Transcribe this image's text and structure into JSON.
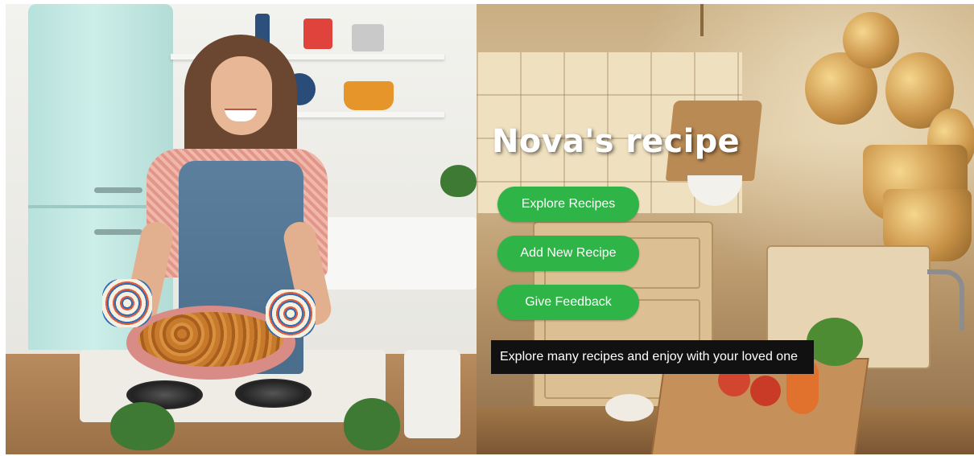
{
  "hero": {
    "title": "Nova's recipe",
    "tagline": "Explore many recipes and enjoy with your loved one"
  },
  "actions": {
    "explore_label": "Explore Recipes",
    "add_label": "Add New Recipe",
    "feedback_label": "Give Feedback"
  },
  "images": {
    "left_photo": "woman-holding-baked-dish-in-kitchen",
    "right_background": "illustrated-warm-kitchen"
  },
  "colors": {
    "button_bg": "#2fb448",
    "button_text": "#ffffff",
    "title_text": "#ffffff",
    "tagline_bg": "#111111"
  }
}
